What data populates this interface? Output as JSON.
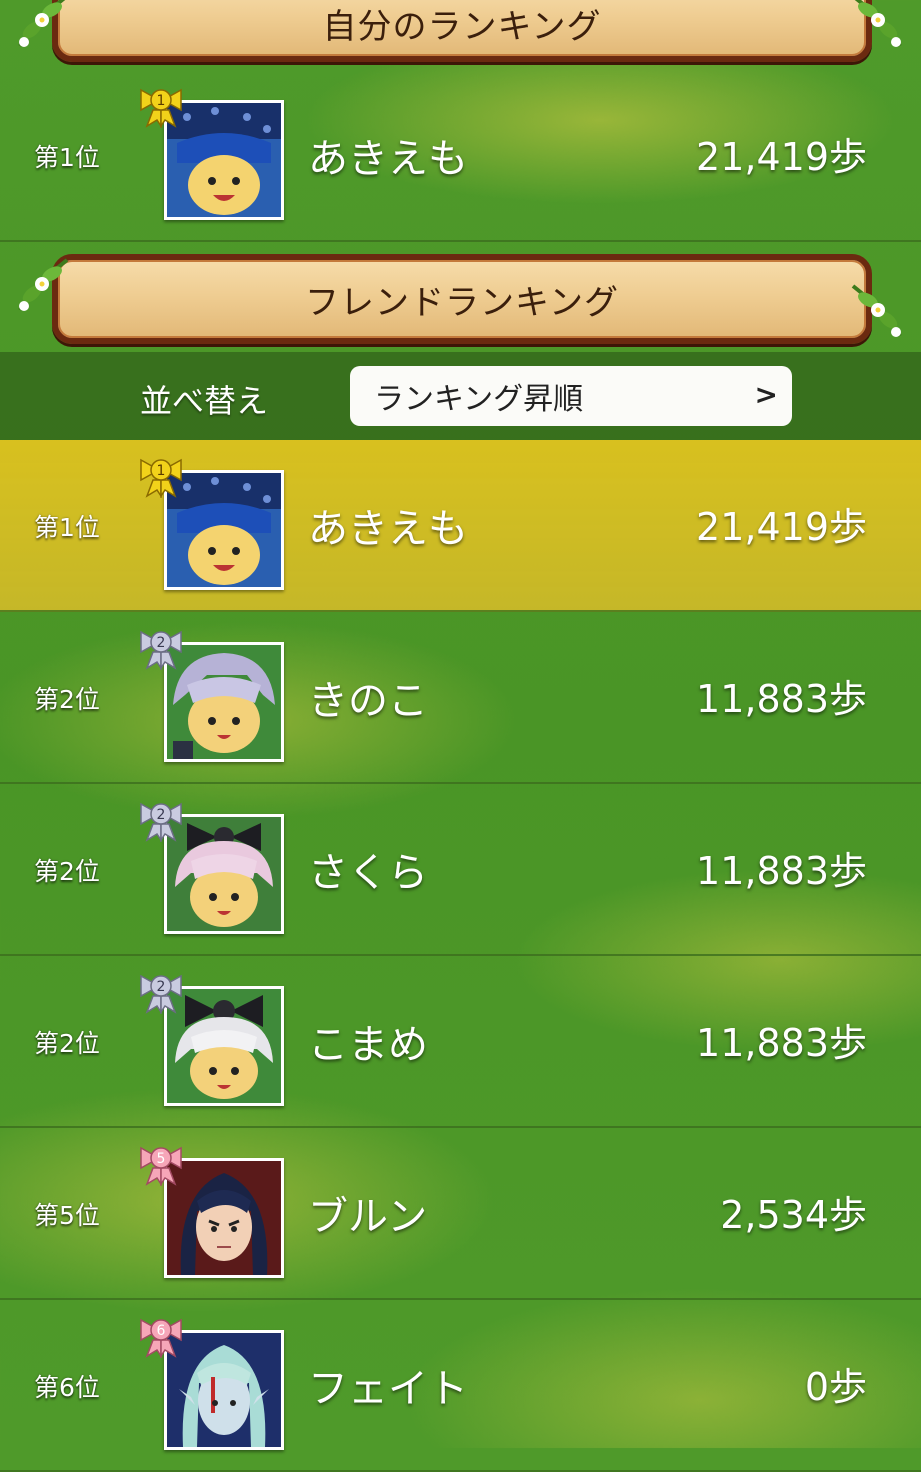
{
  "my_ranking": {
    "title": "自分のランキング",
    "entry": {
      "rank": "第1位",
      "badge": "1",
      "badge_color": "#f2d21a",
      "name": "あきえも",
      "steps": "21,419歩",
      "avatar": "blue-hair-polka-bow"
    }
  },
  "friend_ranking": {
    "title": "フレンドランキング",
    "sort": {
      "label": "並べ替え",
      "value": "ランキング昇順"
    },
    "entries": [
      {
        "rank": "第1位",
        "badge": "1",
        "badge_color": "#f2d21a",
        "name": "あきえも",
        "steps": "21,419歩",
        "avatar": "blue-hair-polka-bow",
        "highlight": true
      },
      {
        "rank": "第2位",
        "badge": "2",
        "badge_color": "#c9cbe0",
        "name": "きのこ",
        "steps": "11,883歩",
        "avatar": "lavender-hair"
      },
      {
        "rank": "第2位",
        "badge": "2",
        "badge_color": "#c9cbe0",
        "name": "さくら",
        "steps": "11,883歩",
        "avatar": "pink-hair-black-bow"
      },
      {
        "rank": "第2位",
        "badge": "2",
        "badge_color": "#c9cbe0",
        "name": "こまめ",
        "steps": "11,883歩",
        "avatar": "white-hair-black-bow"
      },
      {
        "rank": "第5位",
        "badge": "5",
        "badge_color": "#f6a6b8",
        "name": "ブルン",
        "steps": "2,534歩",
        "avatar": "navy-hair-human"
      },
      {
        "rank": "第6位",
        "badge": "6",
        "badge_color": "#f6a6b8",
        "name": "フェイト",
        "steps": "0歩",
        "avatar": "teal-hair-elf"
      }
    ]
  }
}
